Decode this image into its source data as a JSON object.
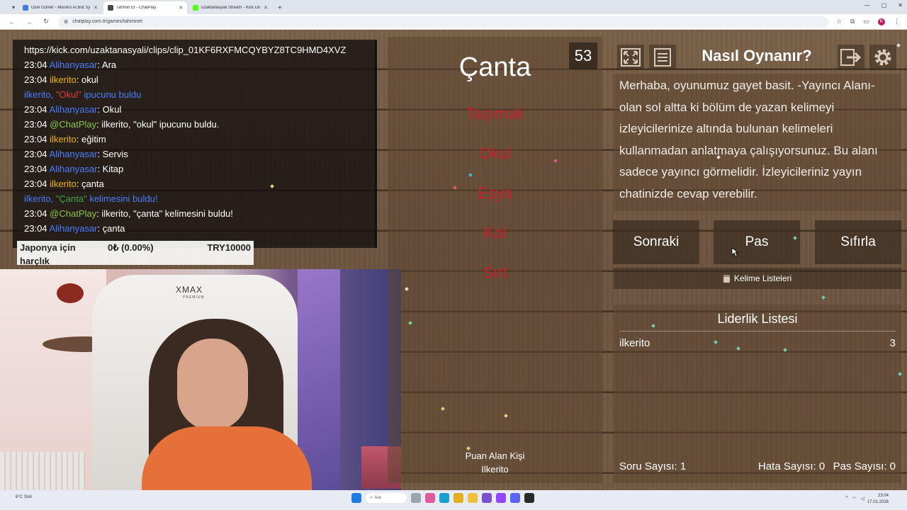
{
  "browser": {
    "tabs": [
      {
        "title": "Özel Günler - MissKo AI Bot Sy",
        "favicon_color": "#3d7dd8",
        "active": false
      },
      {
        "title": "Tahmin Et - ChatPlay",
        "favicon_color": "#4a4a4a",
        "active": true
      },
      {
        "title": "uzaktanasyali Stream - Kick Do",
        "favicon_color": "#53fc18",
        "active": false
      }
    ],
    "url": "chatplay.com.tr/games/tahminet",
    "profile_initial": "K"
  },
  "chat": {
    "lines": [
      {
        "time": "",
        "user": "",
        "user_color": "",
        "text": "https://kick.com/uzaktanasyali/clips/clip_01KF6RXFMCQYBYZ8TC9HMD4XVZ"
      },
      {
        "time": "23:04",
        "user": "Alihanyasar",
        "user_color": "blue",
        "text": ": Ara"
      },
      {
        "time": "23:04",
        "user": "ilkerito",
        "user_color": "gold",
        "text": ": okul"
      },
      {
        "time": "",
        "user": "",
        "user_color": "",
        "system": true,
        "parts": [
          "ilkerito, ",
          "\"Okul\"",
          " ipucunu buldu"
        ]
      },
      {
        "time": "23:04",
        "user": "Alihanyasar",
        "user_color": "blue",
        "text": ": Okul"
      },
      {
        "time": "23:04",
        "user": "@ChatPlay",
        "user_color": "green",
        "text": ": ilkerito, \"okul\" ipucunu buldu."
      },
      {
        "time": "23:04",
        "user": "ilkerito",
        "user_color": "gold",
        "text": ": eğitim"
      },
      {
        "time": "23:04",
        "user": "Alihanyasar",
        "user_color": "blue",
        "text": ": Servis"
      },
      {
        "time": "23:04",
        "user": "Alihanyasar",
        "user_color": "blue",
        "text": ": Kitap"
      },
      {
        "time": "23:04",
        "user": "ilkerito",
        "user_color": "gold",
        "text": ": çanta"
      },
      {
        "time": "",
        "user": "",
        "user_color": "",
        "system": true,
        "parts": [
          "ilkerito, ",
          "\"Çanta\"",
          " kelimesini buldu!"
        ]
      },
      {
        "time": "23:04",
        "user": "@ChatPlay",
        "user_color": "green",
        "text": ": ilkerito, \"çanta\" kelimesini buldu!"
      },
      {
        "time": "23:04",
        "user": "Alihanyasar",
        "user_color": "blue",
        "text": ": çanta"
      }
    ]
  },
  "donation": {
    "label": "Japonya için harçlık",
    "amount": "0₺ (0.00%)",
    "goal": "TRY10000"
  },
  "webcam": {
    "chair_brand": "XMAX",
    "chair_sub": "PREMIUM"
  },
  "game": {
    "timer": "53",
    "word": "Çanta",
    "forbidden_words": [
      "Taşımak",
      "Okul",
      "Eşya",
      "Kol",
      "Sırt"
    ],
    "scorer_label": "Puan Alan Kişi",
    "scorer_name": "Ilkerito"
  },
  "help": {
    "title": "Nasıl Oynanır?",
    "text": "Merhaba, oyunumuz gayet basit. -Yayıncı Alanı- olan sol altta ki bölüm de yazan kelimeyi izleyicilerinize altında bulunan kelimeleri kullanmadan anlatmaya çalışıyorsunuz. Bu alanı sadece yayıncı görmelidir. İzleyicileriniz yayın chatinizde cevap verebilir."
  },
  "actions": {
    "next": "Sonraki",
    "pass": "Pas",
    "reset": "Sıfırla",
    "word_lists": "Kelime Listeleri"
  },
  "leaderboard": {
    "title": "Liderlik Listesi",
    "rows": [
      {
        "name": "ilkerito",
        "score": "3"
      }
    ]
  },
  "stats": {
    "questions": "Soru Sayısı: 1",
    "errors": "Hata Sayısı: 0",
    "passes": "Pas Sayısı: 0"
  },
  "taskbar": {
    "weather": "6°C Sisli",
    "search": "Ara",
    "time": "23:04",
    "date": "17.01.2026"
  },
  "colors": {
    "forbidden": "#d01b2a",
    "user_blue": "#4b7cff",
    "user_gold": "#f4b400",
    "user_green": "#8bc34a"
  }
}
